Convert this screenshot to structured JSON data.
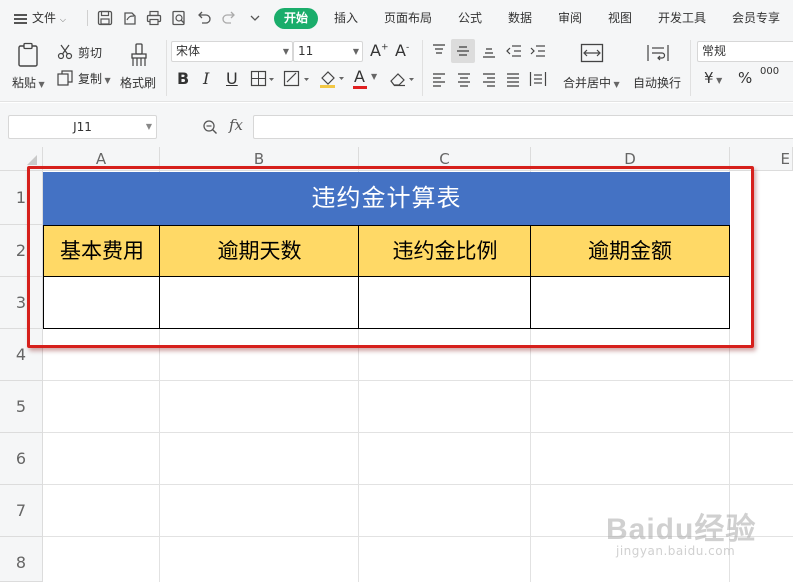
{
  "menubar": {
    "file_label": "文件",
    "tabs": [
      "开始",
      "插入",
      "页面布局",
      "公式",
      "数据",
      "审阅",
      "视图",
      "开发工具",
      "会员专享"
    ]
  },
  "ribbon": {
    "paste_label": "粘贴",
    "cut_label": "剪切",
    "copy_label": "复制",
    "format_painter_label": "格式刷",
    "font_name": "宋体",
    "font_size": "11",
    "merge_center_label": "合并居中",
    "wrap_text_label": "自动换行",
    "number_format": "常规",
    "currency_symbol": "¥",
    "percent_symbol": "%",
    "thousands_symbol": "000",
    "bold_glyph": "B",
    "italic_glyph": "I",
    "underline_glyph": "U",
    "font_color_glyph": "A",
    "font_color": "#e02020"
  },
  "formula_bar": {
    "cell_ref": "J11",
    "fx_label": "fx",
    "formula": ""
  },
  "sheet": {
    "columns": [
      "A",
      "B",
      "C",
      "D",
      "E"
    ],
    "rows": [
      "1",
      "2",
      "3",
      "4",
      "5",
      "6",
      "7",
      "8"
    ],
    "table": {
      "title": "违约金计算表",
      "headers": [
        "基本费用",
        "逾期天数",
        "违约金比例",
        "逾期金额"
      ],
      "row3": [
        "",
        "",
        "",
        ""
      ]
    },
    "title_color": "#4472c4",
    "header_color": "#ffd966",
    "highlight_color": "#d6201c"
  },
  "watermark": {
    "logo": "Baidu经验",
    "url": "jingyan.baidu.com"
  }
}
